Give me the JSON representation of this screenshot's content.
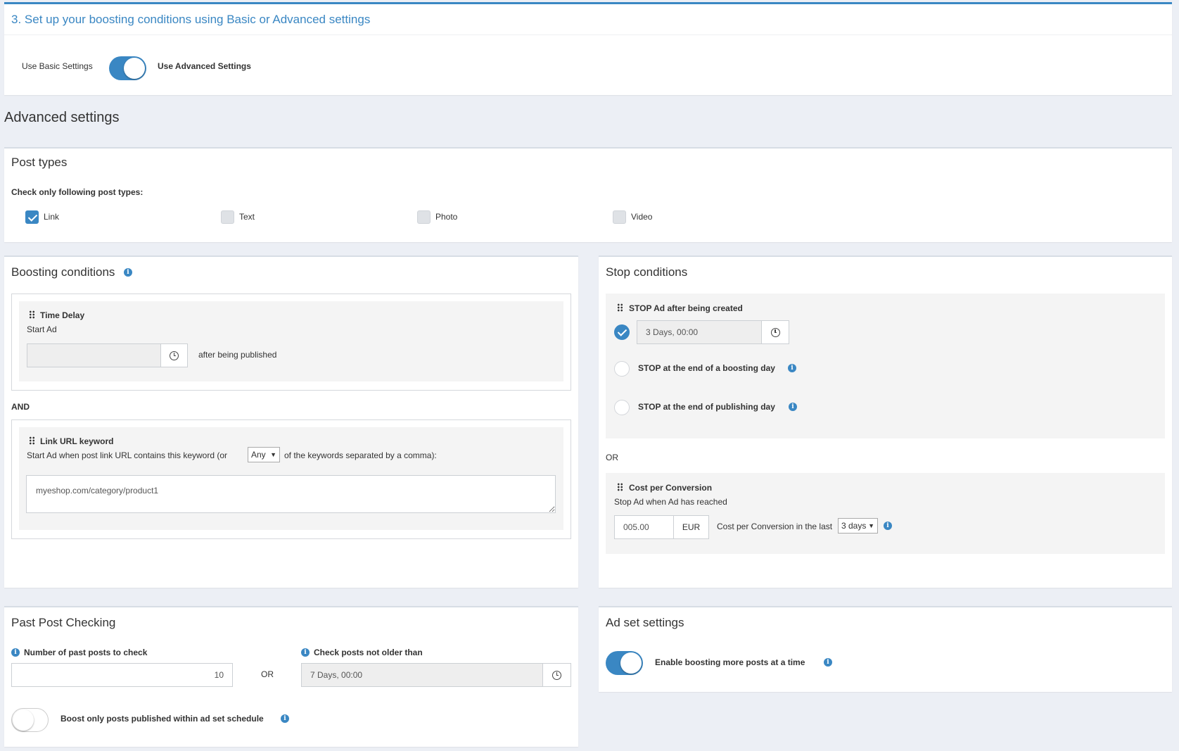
{
  "step": {
    "title": "3. Set up your boosting conditions using Basic or Advanced settings",
    "basic_label": "Use Basic Settings",
    "advanced_label": "Use Advanced Settings",
    "advanced_enabled": true
  },
  "advanced_heading": "Advanced settings",
  "post_types": {
    "title": "Post types",
    "subtitle": "Check only following post types:",
    "items": [
      {
        "label": "Link",
        "checked": true
      },
      {
        "label": "Text",
        "checked": false
      },
      {
        "label": "Photo",
        "checked": false
      },
      {
        "label": "Video",
        "checked": false
      }
    ]
  },
  "boosting": {
    "title": "Boosting conditions",
    "time_delay": {
      "title": "Time Delay",
      "subtitle": "Start Ad",
      "value": "",
      "suffix": "after being published"
    },
    "and_label": "AND",
    "keyword": {
      "title": "Link URL keyword",
      "text_before": "Start Ad when post link URL contains this keyword (or",
      "match_select": "Any",
      "text_after": "of the keywords separated by a comma):",
      "value": "myeshop.com/category/product1"
    }
  },
  "stop": {
    "title": "Stop conditions",
    "after_created": {
      "title": "STOP Ad after being created",
      "value": "3 Days, 00:00",
      "checked": true
    },
    "end_boosting_day": {
      "label": "STOP at the end of a boosting day",
      "checked": false
    },
    "end_publishing_day": {
      "label": "STOP at the end of publishing day",
      "checked": false
    },
    "or_label": "OR",
    "cpc": {
      "title": "Cost per Conversion",
      "subtitle": "Stop Ad when Ad has reached",
      "value": "005.00",
      "currency": "EUR",
      "text": "Cost per Conversion in the last",
      "period": "3 days"
    }
  },
  "past_posts": {
    "title": "Past Post Checking",
    "count_label": "Number of past posts to check",
    "count_value": "10",
    "or_label": "OR",
    "age_label": "Check posts not older than",
    "age_value": "7 Days, 00:00",
    "schedule_label": "Boost only posts published within ad set schedule",
    "schedule_enabled": false
  },
  "adset": {
    "title": "Ad set settings",
    "more_posts_label": "Enable boosting more posts at a time",
    "more_posts_enabled": true
  },
  "colors": {
    "accent": "#3a87c3",
    "background": "#eceff5"
  }
}
